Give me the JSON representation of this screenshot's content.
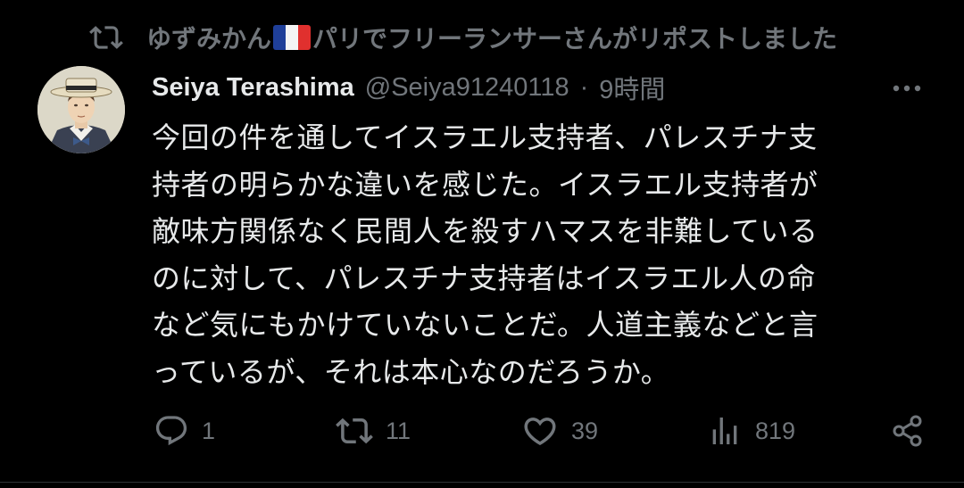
{
  "repost": {
    "user_prefix": "ゆずみかん",
    "user_suffix": "パリでフリーランサーさんがリポストしました"
  },
  "author": {
    "display_name": "Seiya Terashima",
    "handle": "@Seiya91240118",
    "separator": "·",
    "time": "9時間"
  },
  "tweet": {
    "lines": [
      "今回の件を通してイスラエル支持者、パレスチナ支",
      "持者の明らかな違いを感じた。イスラエル支持者が",
      "敵味方関係なく民間人を殺すハマスを非難している",
      "のに対して、パレスチナ支持者はイスラエル人の命",
      "など気にもかけていないことだ。人道主義などと言",
      "っているが、それは本心なのだろうか。"
    ]
  },
  "actions": {
    "reply_count": "1",
    "repost_count": "11",
    "like_count": "39",
    "view_count": "819"
  },
  "icons": {
    "repost": "repost-icon",
    "flag": "france-flag-icon",
    "more": "more-icon",
    "reply": "reply-icon",
    "like": "heart-icon",
    "views": "views-icon",
    "share": "share-icon"
  },
  "colors": {
    "background": "#000000",
    "text_primary": "#e7e9ea",
    "text_secondary": "#71767b"
  }
}
